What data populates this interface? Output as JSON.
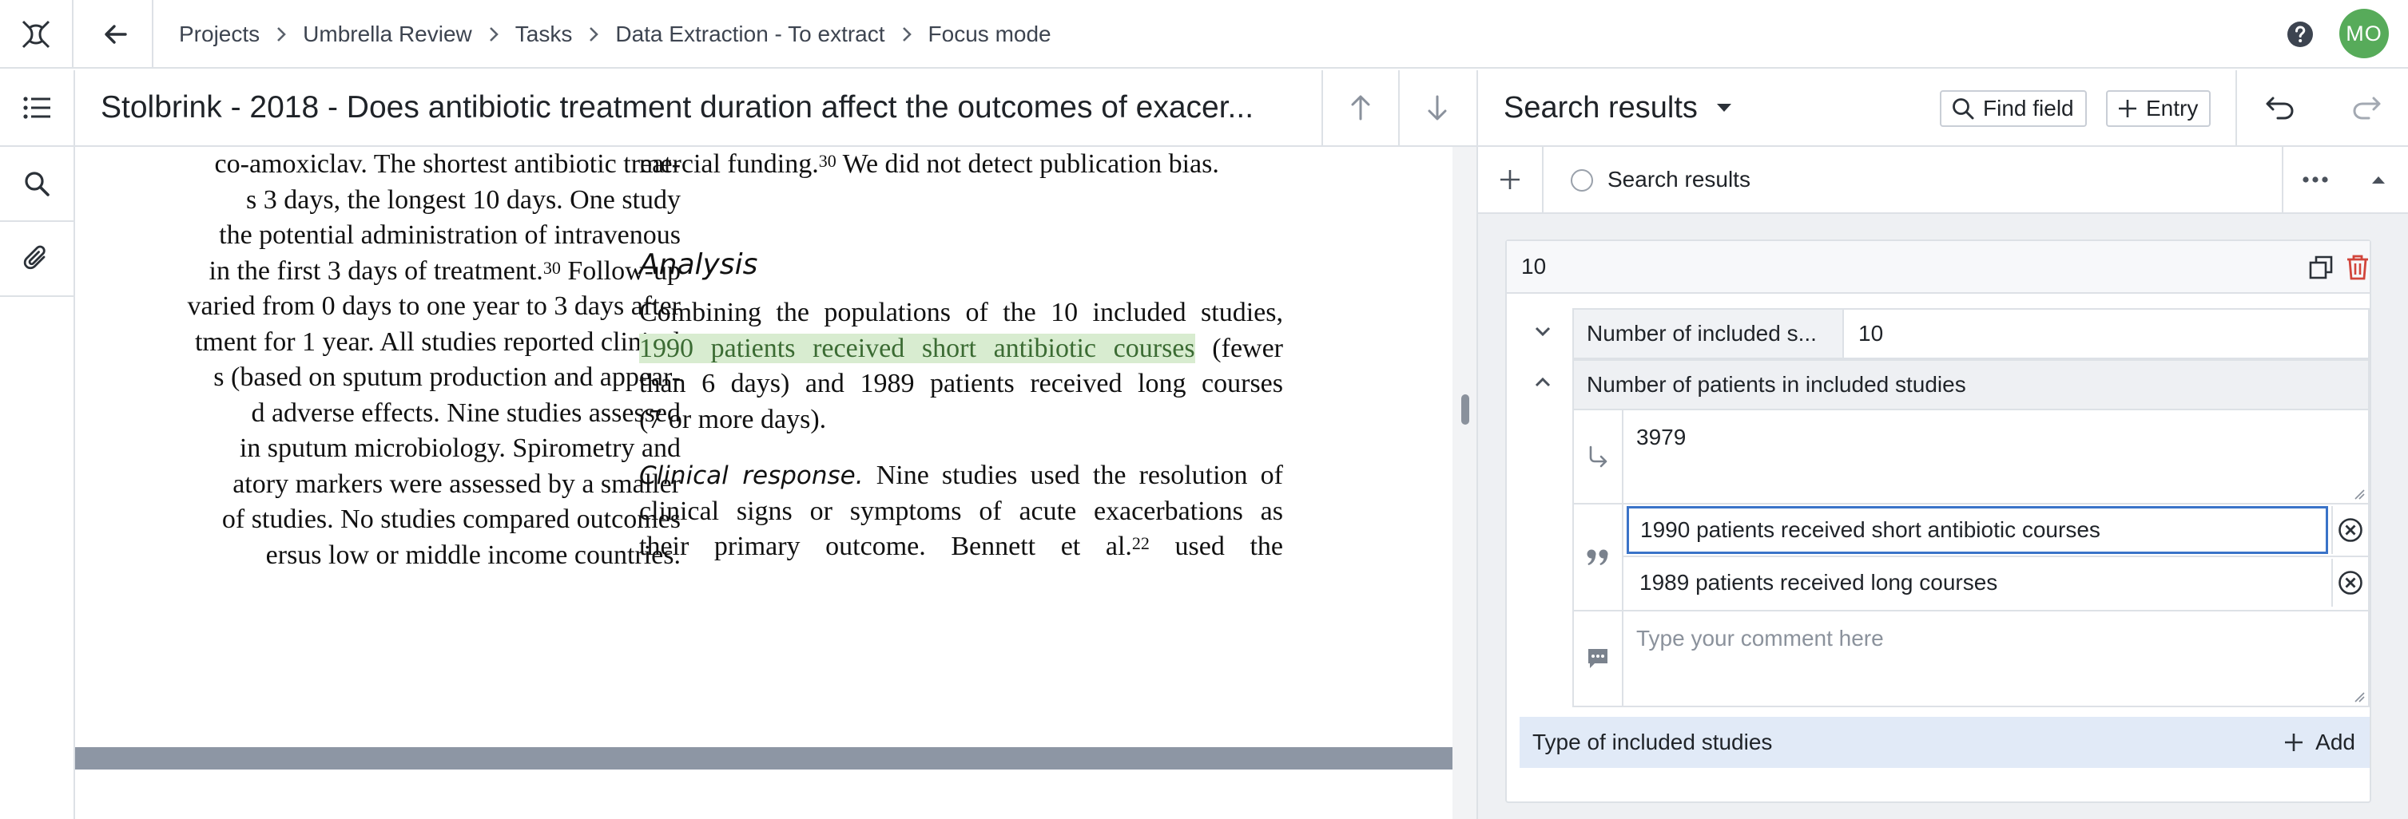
{
  "breadcrumb": [
    "Projects",
    "Umbrella Review",
    "Tasks",
    "Data Extraction - To extract",
    "Focus mode"
  ],
  "user": {
    "initials": "MO",
    "color": "#57ab5a"
  },
  "document": {
    "title": "Stolbrink - 2018 - Does antibiotic treatment duration affect the outcomes of exacer...",
    "left_lines": [
      "co-amoxiclav. The shortest antibiotic treat-",
      "s 3 days, the longest 10 days. One study",
      "the potential administration of intravenous",
      "in the first 3 days of treatment.",
      "varied from 0 days to one year to 3 days after",
      "tment for 1 year. All studies reported clinical",
      "s (based on sputum production and appear-",
      "d adverse effects. Nine studies assessed",
      "in sputum microbiology. Spirometry and",
      "atory markers were assessed by a smaller",
      "of studies. No studies compared outcomes",
      "ersus low or middle income countries."
    ],
    "left_line4_sup": "30",
    "left_line4_tail": " Follow-up",
    "top_line": "mercial funding.",
    "top_line_sup": "30",
    "top_line_tail": " We did not detect publication bias.",
    "analysis_heading": "Analysis",
    "analysis_line1": "Combining the populations of the 10 included studies,",
    "highlight": "1990 patients received short antibiotic courses",
    "analysis_line2_tail": " (fewer",
    "analysis_line3": "than 6 days) and 1989 patients received long courses",
    "analysis_line4": "(7 or more days).",
    "clinical_runin": "Clinical response.",
    "clinical_line1_tail": " Nine studies used the resolution of",
    "clinical_line2": "clinical signs or symptoms of acute exacerbations as",
    "clinical_line3": "their primary outcome. Bennett et al.",
    "clinical_line3_sup": "22",
    "clinical_line3_tail": " used the"
  },
  "panel": {
    "title": "Search results",
    "find_field_label": "Find field",
    "entry_label": "Entry",
    "strip_label": "Search results",
    "card_number": "10",
    "fields": {
      "included_label": "Number of included s...",
      "included_value": "10",
      "patients_label": "Number of patients in included studies",
      "patients_answer": "3979",
      "quotes": [
        "1990 patients received short antibiotic courses",
        "1989 patients received long courses"
      ],
      "comment_placeholder": "Type your comment here",
      "type_label": "Type of included studies",
      "add_label": "Add"
    }
  },
  "colors": {
    "accent": "#3a73c8",
    "delete": "#d1453b",
    "highlight_bg": "#d8ecd0",
    "add_row_bg": "#e1eaf7"
  },
  "icons": [
    "logo-icon",
    "arrow-left-icon",
    "chevron-right-icon",
    "help-icon",
    "list-icon",
    "search-icon",
    "paperclip-icon",
    "arrow-up-icon",
    "arrow-down-icon",
    "caret-down-icon",
    "undo-icon",
    "redo-icon",
    "plus-icon",
    "more-icon",
    "copy-icon",
    "trash-icon",
    "chevron-down-icon",
    "chevron-up-icon",
    "answer-arrow-icon",
    "quote-icon",
    "clear-icon",
    "comment-icon"
  ]
}
